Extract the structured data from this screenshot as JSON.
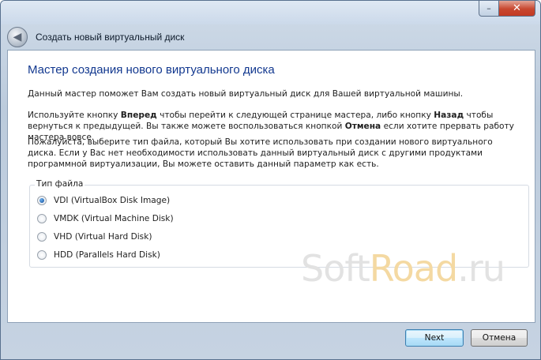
{
  "window": {
    "title": "Создать новый виртуальный диск",
    "minimize_glyph": "–",
    "close_glyph": "✕",
    "back_glyph": "◀"
  },
  "wizard": {
    "heading": "Мастер создания нового виртуального диска",
    "intro": "Данный мастер поможет Вам создать новый виртуальный диск для Вашей виртуальной машины.",
    "nav_text": {
      "a": "Используйте кнопку ",
      "b": "Вперед",
      "c": " чтобы перейти к следующей странице мастера, либо кнопку ",
      "d": "Назад",
      "e": " чтобы вернуться к предыдущей. Вы также можете воспользоваться кнопкой ",
      "f": "Отмена",
      "g": " если хотите прервать работу мастера вовсе."
    },
    "choose_text": "Пожалуйста, выберите тип файла, который Вы хотите использовать при создании нового виртуального диска. Если у Вас нет необходимости использовать данный виртуальный диск с другими продуктами программной виртуализации, Вы можете оставить данный параметр как есть."
  },
  "file_type": {
    "legend": "Тип файла",
    "options": [
      {
        "label": "VDI (VirtualBox Disk Image)",
        "checked": true
      },
      {
        "label": "VMDK (Virtual Machine Disk)",
        "checked": false
      },
      {
        "label": "VHD (Virtual Hard Disk)",
        "checked": false
      },
      {
        "label": "HDD (Parallels Hard Disk)",
        "checked": false
      }
    ]
  },
  "watermark": {
    "part1": "Soft",
    "part2": "Road",
    "part3": ".ru"
  },
  "buttons": {
    "next": "Next",
    "cancel": "Отмена"
  },
  "colors": {
    "heading": "#12388f",
    "watermark_accent": "#f4d9a2"
  }
}
